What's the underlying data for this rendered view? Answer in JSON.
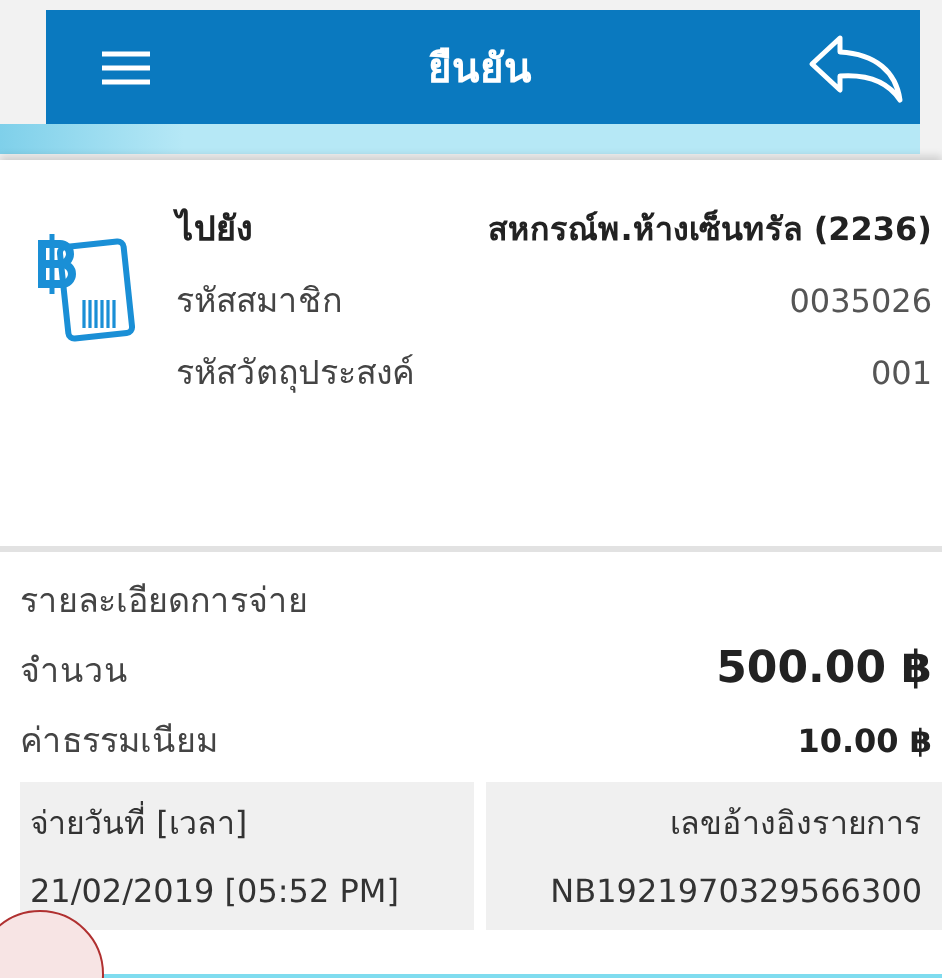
{
  "header": {
    "title": "ยืนยัน"
  },
  "recipient": {
    "rows": [
      {
        "label": "ไปยัง",
        "value": "สหกรณ์พ.ห้างเซ็นทรัล (2236)",
        "kind": "heading"
      },
      {
        "label": "รหัสสมาชิก",
        "value": "0035026",
        "kind": "plain"
      },
      {
        "label": "รหัสวัตถุประสงค์",
        "value": "001",
        "kind": "plain"
      }
    ]
  },
  "payment": {
    "title": "รายละเอียดการจ่าย",
    "rows": [
      {
        "label": "จำนวน",
        "value": "500.00 ฿",
        "kind": "large"
      },
      {
        "label": "ค่าธรรมเนียม",
        "value": "10.00 ฿",
        "kind": "medium"
      }
    ],
    "boxes": [
      {
        "label": "จ่ายวันที่ [เวลา]",
        "value": "21/02/2019 [05:52 PM]",
        "kind": "start"
      },
      {
        "label": "เลขอ้างอิงรายการ",
        "value": "NB1921970329566300",
        "kind": "end"
      }
    ]
  }
}
